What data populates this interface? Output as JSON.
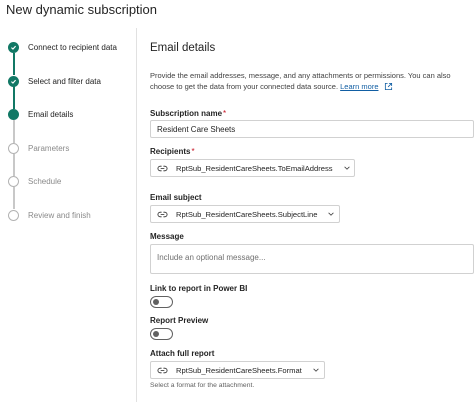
{
  "title": "New dynamic subscription",
  "steps": [
    {
      "label": "Connect to recipient data",
      "state": "done"
    },
    {
      "label": "Select and filter data",
      "state": "done"
    },
    {
      "label": "Email details",
      "state": "current"
    },
    {
      "label": "Parameters",
      "state": "todo"
    },
    {
      "label": "Schedule",
      "state": "todo"
    },
    {
      "label": "Review and finish",
      "state": "todo"
    }
  ],
  "email_details": {
    "heading": "Email details",
    "description": "Provide the email addresses, message, and any attachments or permissions. You can also choose to get the data from your connected data source.",
    "learn_more": "Learn more",
    "subscription_name": {
      "label": "Subscription name",
      "required": "*",
      "value": "Resident Care Sheets"
    },
    "recipients": {
      "label": "Recipients",
      "required": "*",
      "value": "RptSub_ResidentCareSheets.ToEmailAddress"
    },
    "email_subject": {
      "label": "Email subject",
      "value": "RptSub_ResidentCareSheets.SubjectLine"
    },
    "message": {
      "label": "Message",
      "placeholder": "Include an optional message..."
    },
    "link_to_report": {
      "label": "Link to report in Power BI",
      "on": false
    },
    "report_preview": {
      "label": "Report Preview",
      "on": false
    },
    "attach_full_report": {
      "label": "Attach full report",
      "value": "RptSub_ResidentCareSheets.Format",
      "hint": "Select a format for the attachment."
    }
  },
  "colors": {
    "accent": "#117865",
    "link": "#115ea3",
    "required": "#c50f1f"
  }
}
